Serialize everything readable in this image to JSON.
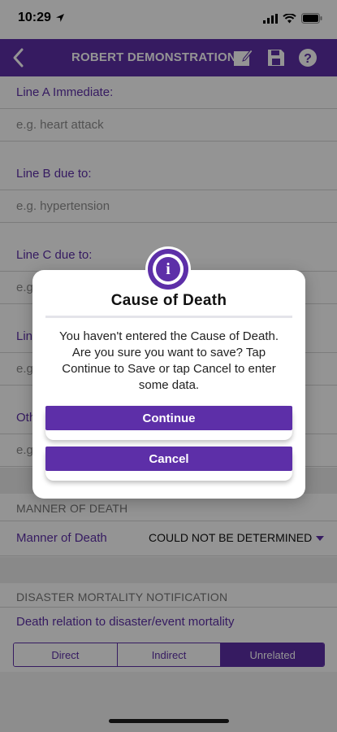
{
  "status_bar": {
    "time": "10:29"
  },
  "header": {
    "title": "ROBERT DEMONSTRATION",
    "icons": [
      "back-chevron-icon",
      "edit-note-icon",
      "save-disk-icon",
      "help-icon"
    ]
  },
  "form": {
    "line_a_label": "Line A Immediate:",
    "line_a_placeholder": "e.g. heart attack",
    "line_b_label": "Line B due to:",
    "line_b_placeholder": "e.g. hypertension",
    "line_c_label": "Line C due to:",
    "line_c_placeholder": "e.g",
    "line_d_label": "Lin",
    "line_d_placeholder": "e.g",
    "other_label": "Oth",
    "other_placeholder": "e.g"
  },
  "manner": {
    "section_title": "MANNER OF DEATH",
    "label": "Manner of Death",
    "value": "COULD NOT BE DETERMINED"
  },
  "disaster": {
    "section_title": "DISASTER MORTALITY NOTIFICATION",
    "label": "Death relation to disaster/event mortality",
    "options": [
      "Direct",
      "Indirect",
      "Unrelated"
    ],
    "selected": "Unrelated"
  },
  "dialog": {
    "title": "Cause of Death",
    "message": "You haven't entered the Cause of Death. Are you sure you want to save? Tap Continue to Save or tap Cancel to enter some data.",
    "continue_label": "Continue",
    "cancel_label": "Cancel"
  },
  "colors": {
    "accent": "#5d2fa8"
  }
}
